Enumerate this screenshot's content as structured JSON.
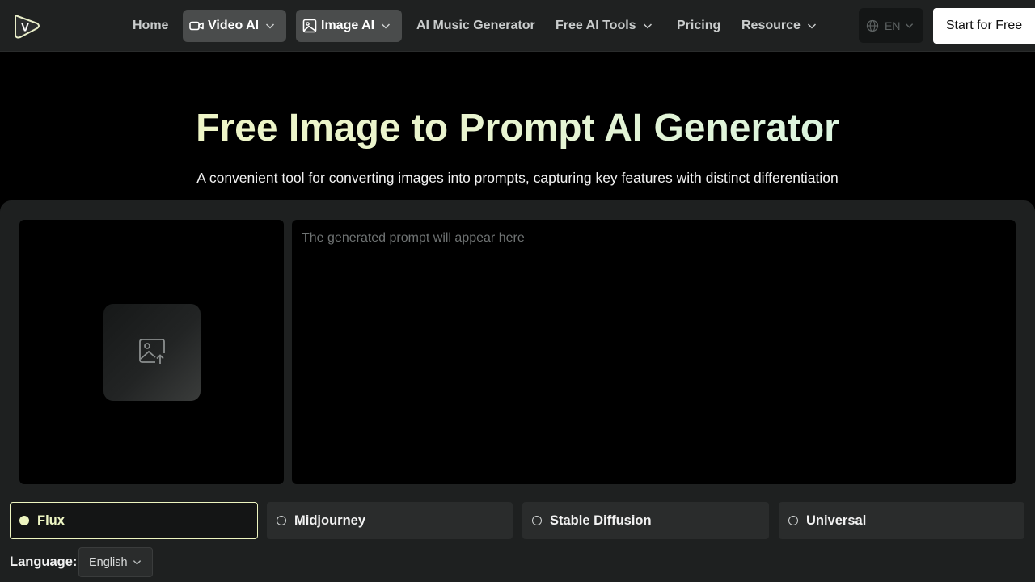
{
  "nav": {
    "logo_letter": "V",
    "items": [
      {
        "label": "Home"
      },
      {
        "label": "Video AI"
      },
      {
        "label": "Image AI"
      },
      {
        "label": "AI Music Generator"
      },
      {
        "label": "Free AI Tools"
      },
      {
        "label": "Pricing"
      },
      {
        "label": "Resource"
      }
    ],
    "language_code": "EN",
    "cta_label": "Start for Free"
  },
  "hero": {
    "title": "Free Image to Prompt AI Generator",
    "subtitle": "A convenient tool for converting images into prompts, capturing key features with distinct differentiation"
  },
  "workspace": {
    "prompt_placeholder": "The generated prompt will appear here",
    "models": [
      {
        "label": "Flux",
        "selected": true
      },
      {
        "label": "Midjourney",
        "selected": false
      },
      {
        "label": "Stable Diffusion",
        "selected": false
      },
      {
        "label": "Universal",
        "selected": false
      }
    ],
    "language_label": "Language:",
    "language_value": "English"
  },
  "colors": {
    "accent": "#eef5c0",
    "background": "#000000",
    "panel": "#1e2020",
    "nav": "#1f2121"
  },
  "icons": [
    "logo-icon",
    "video-camera-icon",
    "image-icon",
    "chevron-down-icon",
    "globe-icon",
    "image-upload-icon"
  ]
}
